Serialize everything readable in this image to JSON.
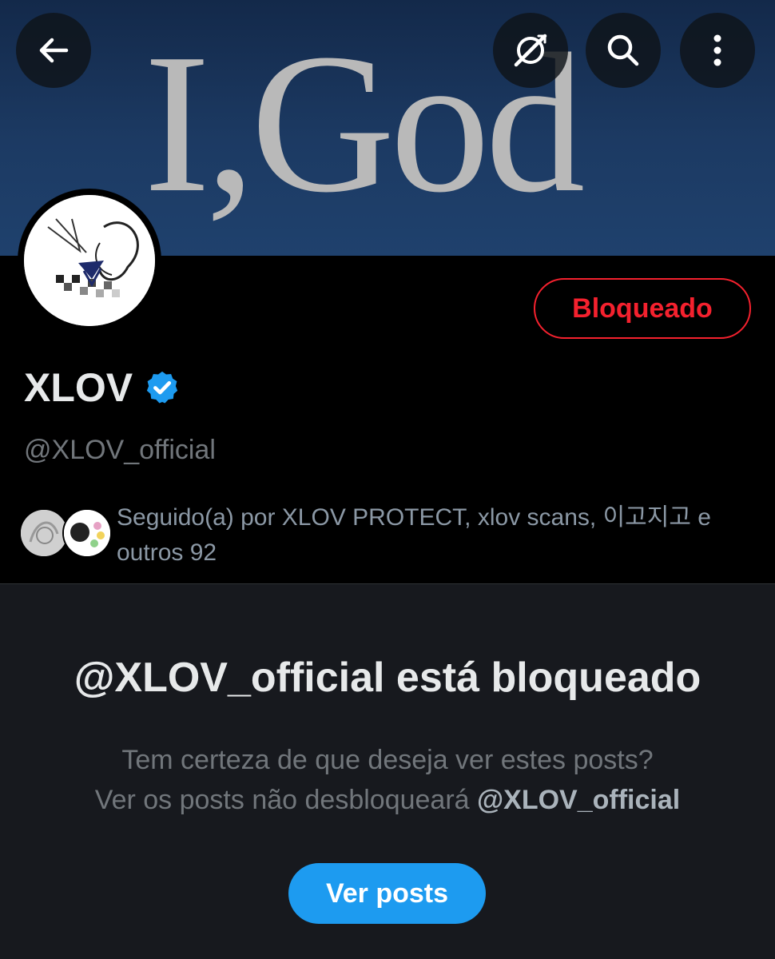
{
  "banner": {
    "text": "I,God"
  },
  "header": {
    "back_icon": "arrow-left-icon",
    "grok_icon": "grok-icon",
    "search_icon": "search-icon",
    "more_icon": "more-vertical-icon"
  },
  "profile": {
    "display_name": "XLOV",
    "verified_icon": "verified-badge-icon",
    "handle": "@XLOV_official",
    "relationship_button": "Bloqueado",
    "followed_by": "Seguido(a) por XLOV PROTECT, xlov scans, 이고지고 e outros 92"
  },
  "blocked_notice": {
    "title": "@XLOV_official está bloqueado",
    "line1": "Tem certeza de que deseja ver estes posts?",
    "line2_prefix": "Ver os posts não desbloqueará ",
    "line2_handle": "@XLOV_official",
    "button": "Ver posts"
  },
  "colors": {
    "accent_blue": "#1d9bf0",
    "blocked_red": "#f4212e",
    "background": "#000000",
    "notice_background": "#17191e"
  }
}
